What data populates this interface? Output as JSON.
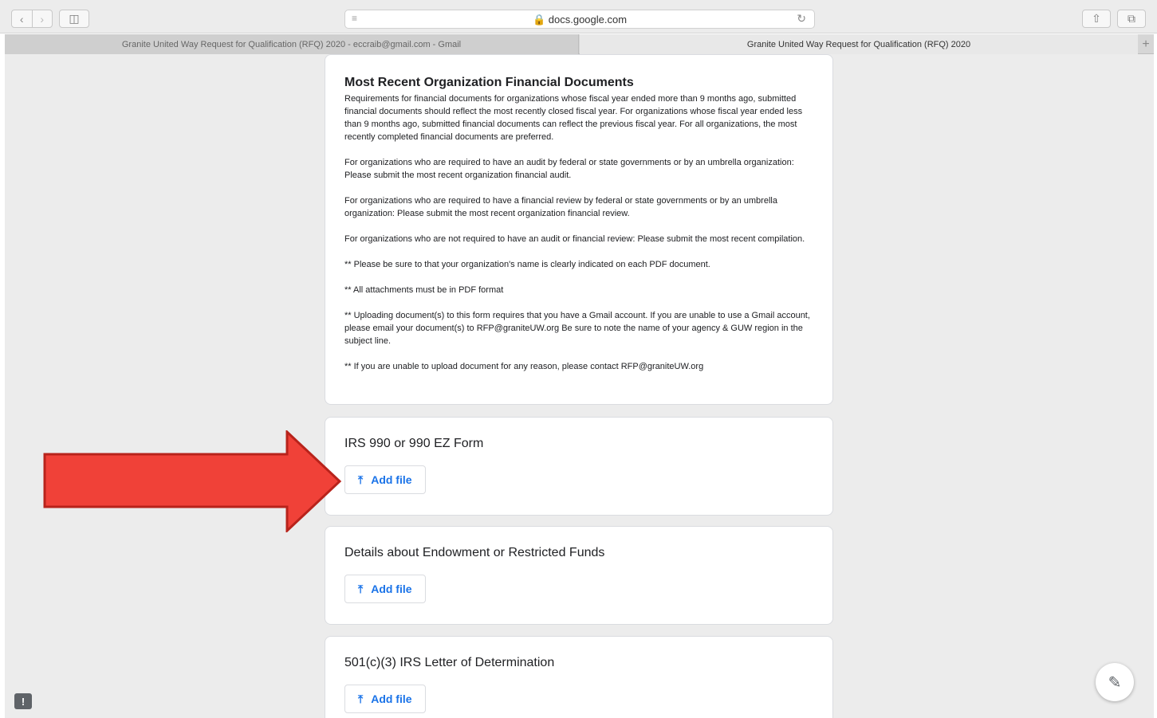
{
  "browser": {
    "url": "docs.google.com",
    "tabs": [
      {
        "label": "Granite United Way Request for Qualification (RFQ) 2020 - eccraib@gmail.com - Gmail"
      },
      {
        "label": "Granite United Way Request for Qualification (RFQ) 2020"
      }
    ],
    "new_tab": "+"
  },
  "section": {
    "title": "Most Recent Organization Financial Documents",
    "paragraphs": [
      "Requirements for financial documents for organizations whose fiscal year ended more than 9 months ago, submitted financial documents should reflect the most recently closed fiscal year. For organizations whose fiscal year ended less than 9 months ago, submitted financial documents can reflect the previous fiscal year. For all organizations, the most recently completed financial documents are preferred.",
      "For organizations who are required to have an audit by federal or state governments or by an umbrella organization: Please submit the most recent organization financial audit.",
      "For organizations who are required to have a financial review by federal or state governments or by an umbrella organization: Please submit the most recent organization financial review.",
      "For organizations who are not required to have an audit or financial review: Please submit the most recent compilation.",
      "** Please be sure to that your organization's name is clearly indicated on each PDF document.",
      "** All attachments must be in PDF format",
      "** Uploading document(s) to this form requires that you have a Gmail account. If you are unable to use a Gmail account, please email your document(s) to RFP@graniteUW.org Be sure to note the name of your agency & GUW region in the subject line.",
      "** If you are unable to upload document for any reason, please contact RFP@graniteUW.org"
    ]
  },
  "questions": [
    {
      "title": "IRS 990 or 990 EZ Form",
      "button": "Add file"
    },
    {
      "title": "Details about Endowment or Restricted Funds",
      "button": "Add file"
    },
    {
      "title": "501(c)(3) IRS Letter of Determination",
      "button": "Add file"
    }
  ],
  "colors": {
    "accent": "#1a73e8",
    "arrow": "#f04138"
  },
  "icons": {
    "upload": "upload-icon",
    "edit": "pencil-icon",
    "feedback": "feedback-icon"
  }
}
